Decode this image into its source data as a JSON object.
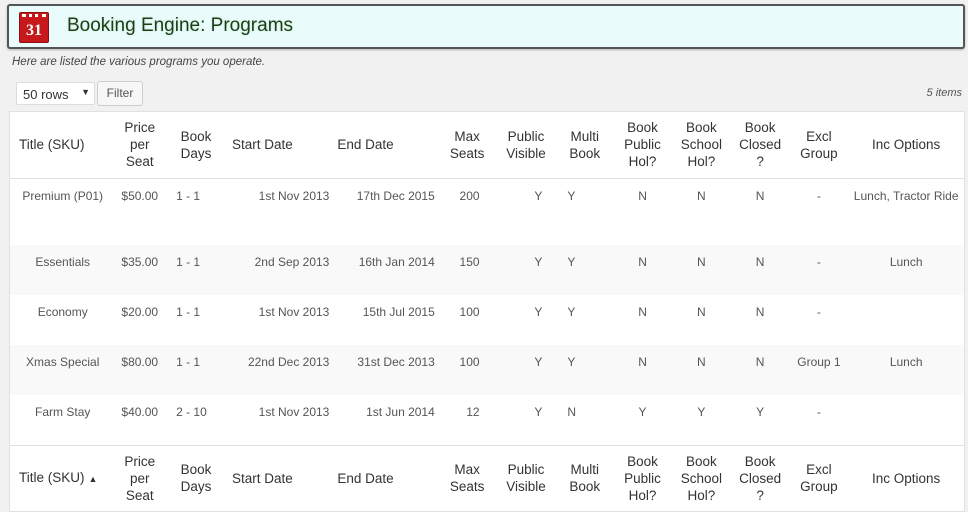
{
  "header": {
    "icon_number": "31",
    "title": "Booking Engine: Programs"
  },
  "subtitle": "Here are listed the various programs you operate.",
  "controls": {
    "rows_selected": "50 rows",
    "filter_label": "Filter",
    "items_count": "5 items"
  },
  "columns": {
    "title": "Title (SKU)",
    "price": "Price per Seat",
    "days": "Book Days",
    "start": "Start Date",
    "end": "End Date",
    "max": "Max Seats",
    "visible": "Public Visible",
    "multi": "Multi Book",
    "pubhol": "Book Public Hol?",
    "schhol": "Book School Hol?",
    "closed": "Book Closed ?",
    "excl": "Excl Group",
    "inc": "Inc Options"
  },
  "rows": [
    {
      "title": "Premium (P01)",
      "price": "$50.00",
      "days": "1 - 1",
      "start": "1st Nov 2013",
      "end": "17th Dec 2015",
      "max": "200",
      "visible": "Y",
      "multi": "Y",
      "pubhol": "N",
      "schhol": "N",
      "closed": "N",
      "excl": "-",
      "inc": "Lunch, Tractor Ride"
    },
    {
      "title": "Essentials",
      "price": "$35.00",
      "days": "1 - 1",
      "start": "2nd Sep 2013",
      "end": "16th Jan 2014",
      "max": "150",
      "visible": "Y",
      "multi": "Y",
      "pubhol": "N",
      "schhol": "N",
      "closed": "N",
      "excl": "-",
      "inc": "Lunch"
    },
    {
      "title": "Economy",
      "price": "$20.00",
      "days": "1 - 1",
      "start": "1st Nov 2013",
      "end": "15th Jul 2015",
      "max": "100",
      "visible": "Y",
      "multi": "Y",
      "pubhol": "N",
      "schhol": "N",
      "closed": "N",
      "excl": "-",
      "inc": ""
    },
    {
      "title": "Xmas Special",
      "price": "$80.00",
      "days": "1 - 1",
      "start": "22nd Dec 2013",
      "end": "31st Dec 2013",
      "max": "100",
      "visible": "Y",
      "multi": "Y",
      "pubhol": "N",
      "schhol": "N",
      "closed": "N",
      "excl": "Group 1",
      "inc": "Lunch"
    },
    {
      "title": "Farm Stay",
      "price": "$40.00",
      "days": "2 - 10",
      "start": "1st Nov 2013",
      "end": "1st Jun 2014",
      "max": "12",
      "visible": "Y",
      "multi": "N",
      "pubhol": "Y",
      "schhol": "Y",
      "closed": "Y",
      "excl": "-",
      "inc": ""
    }
  ],
  "icons": {
    "calendar": "calendar-icon",
    "select_arrow": "chevron-down-icon",
    "sort": "sort-ascending-icon"
  }
}
